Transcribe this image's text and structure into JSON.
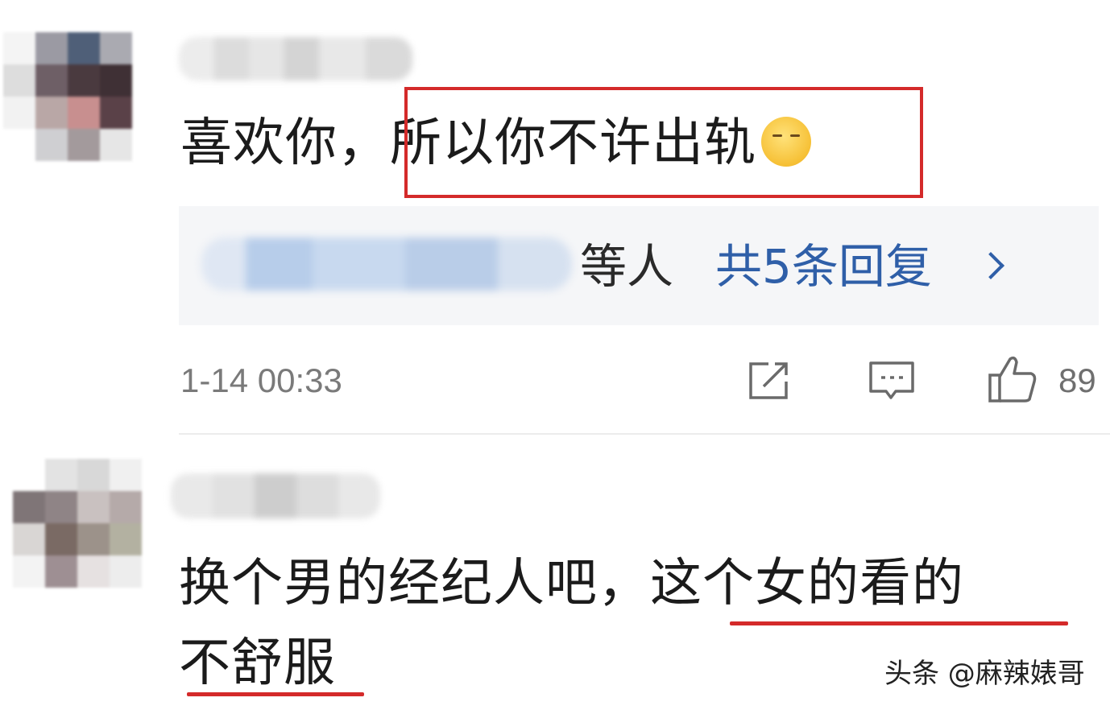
{
  "comment1": {
    "text_plain": "喜欢你，",
    "text_highlight": "所以你不许出轨",
    "emoji": "shush-face-emoji",
    "replies": {
      "suffix": "等人",
      "count_text": "共5条回复"
    },
    "timestamp": "1-14 00:33",
    "like_count": "89"
  },
  "comment2": {
    "text_line1_plain": "换个男的经纪人吧，",
    "text_line1_underlined": "这个女的看的",
    "text_line2_underlined": "不舒服"
  },
  "watermark": "头条 @麻辣婊哥",
  "colors": {
    "highlight_red": "#d42a2a",
    "link_blue": "#2f5fa8",
    "reply_bg": "#f5f6f8"
  },
  "icons": [
    "share-icon",
    "comment-icon",
    "like-icon",
    "chevron-right-icon"
  ]
}
